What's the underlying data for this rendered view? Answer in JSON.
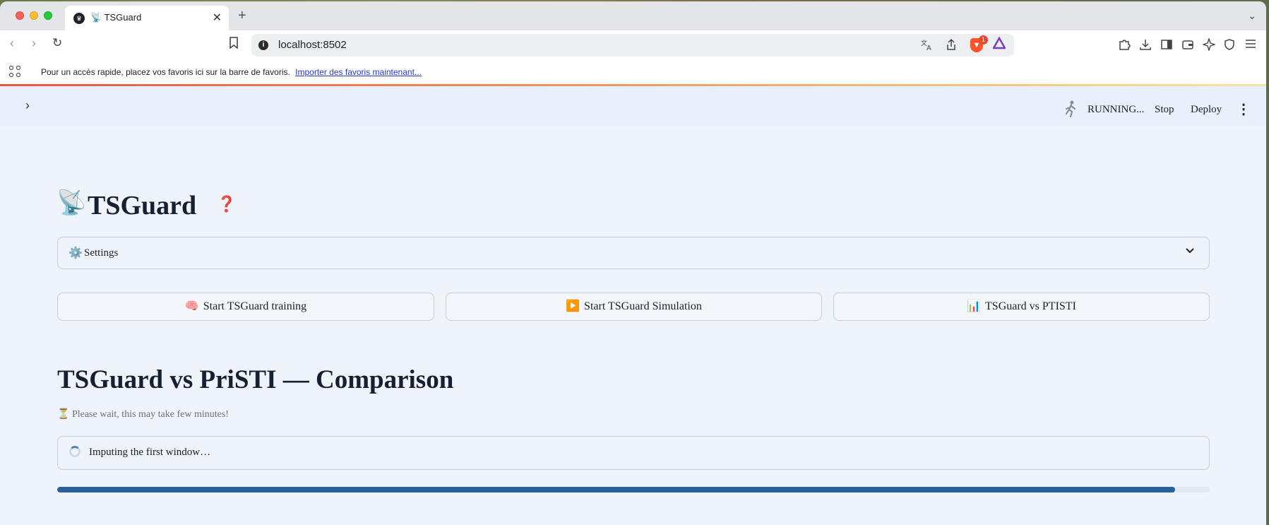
{
  "browser": {
    "tab": {
      "title": "📡 TSGuard",
      "close": "✕"
    },
    "new_tab": "+",
    "tab_menu": "⌄",
    "nav": {
      "back": "‹",
      "forward": "›",
      "reload": "↻"
    },
    "url": "localhost:8502",
    "shield_badge": "1",
    "bookmarks_bar": {
      "message": "Pour un accès rapide, placez vos favoris ici sur la barre de favoris.",
      "link": "Importer des favoris maintenant..."
    }
  },
  "app_header": {
    "status": "RUNNING...",
    "stop_label": "Stop",
    "deploy_label": "Deploy",
    "menu_glyph": "⋮",
    "sidebar_glyph": "›"
  },
  "page": {
    "title_emoji": "📡",
    "title": "TSGuard",
    "help_glyph": "❓",
    "settings": {
      "emoji": "⚙️",
      "label": "Settings",
      "chevron": "⌄"
    },
    "buttons": [
      {
        "emoji": "🧠",
        "label": "Start TSGuard training"
      },
      {
        "emoji": "▶️",
        "label": "Start TSGuard Simulation"
      },
      {
        "emoji": "📊",
        "label": "TSGuard vs PTISTI"
      }
    ],
    "section_title": "TSGuard vs PriSTI — Comparison",
    "wait_emoji": "⏳",
    "wait_message": "Please wait, this may take few minutes!",
    "status_message": "Imputing the first window…",
    "progress": 0.97
  },
  "colors": {
    "accent": "#2a5f9e",
    "help": "#d92c2c",
    "link": "#2a36c9"
  },
  "icons": {
    "running": "running-man-icon",
    "translate": "translate-icon",
    "share": "share-icon",
    "extensions": "puzzle-icon",
    "download": "download-icon",
    "sidebar": "sidebar-icon",
    "wallet": "wallet-icon",
    "leo": "sparkle-icon",
    "vpn": "vpn-icon",
    "menu": "hamburger-icon"
  }
}
